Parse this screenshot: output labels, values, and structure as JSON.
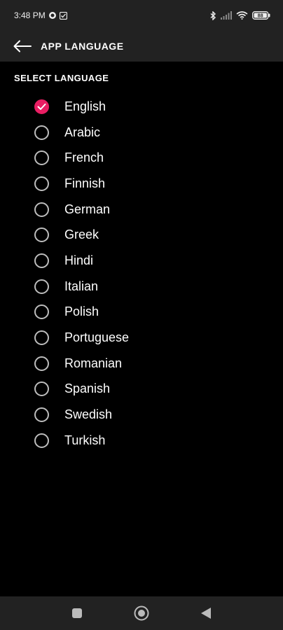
{
  "status_bar": {
    "time": "3:48 PM",
    "battery": "88"
  },
  "app_bar": {
    "title": "APP LANGUAGE"
  },
  "section": {
    "title": "SELECT LANGUAGE"
  },
  "selected_language": "English",
  "languages": [
    "English",
    "Arabic",
    "French",
    "Finnish",
    "German",
    "Greek",
    "Hindi",
    "Italian",
    "Polish",
    "Portuguese",
    "Romanian",
    "Spanish",
    "Swedish",
    "Turkish"
  ],
  "colors": {
    "accent": "#e91e63",
    "background": "#000000",
    "bar": "#222222"
  }
}
